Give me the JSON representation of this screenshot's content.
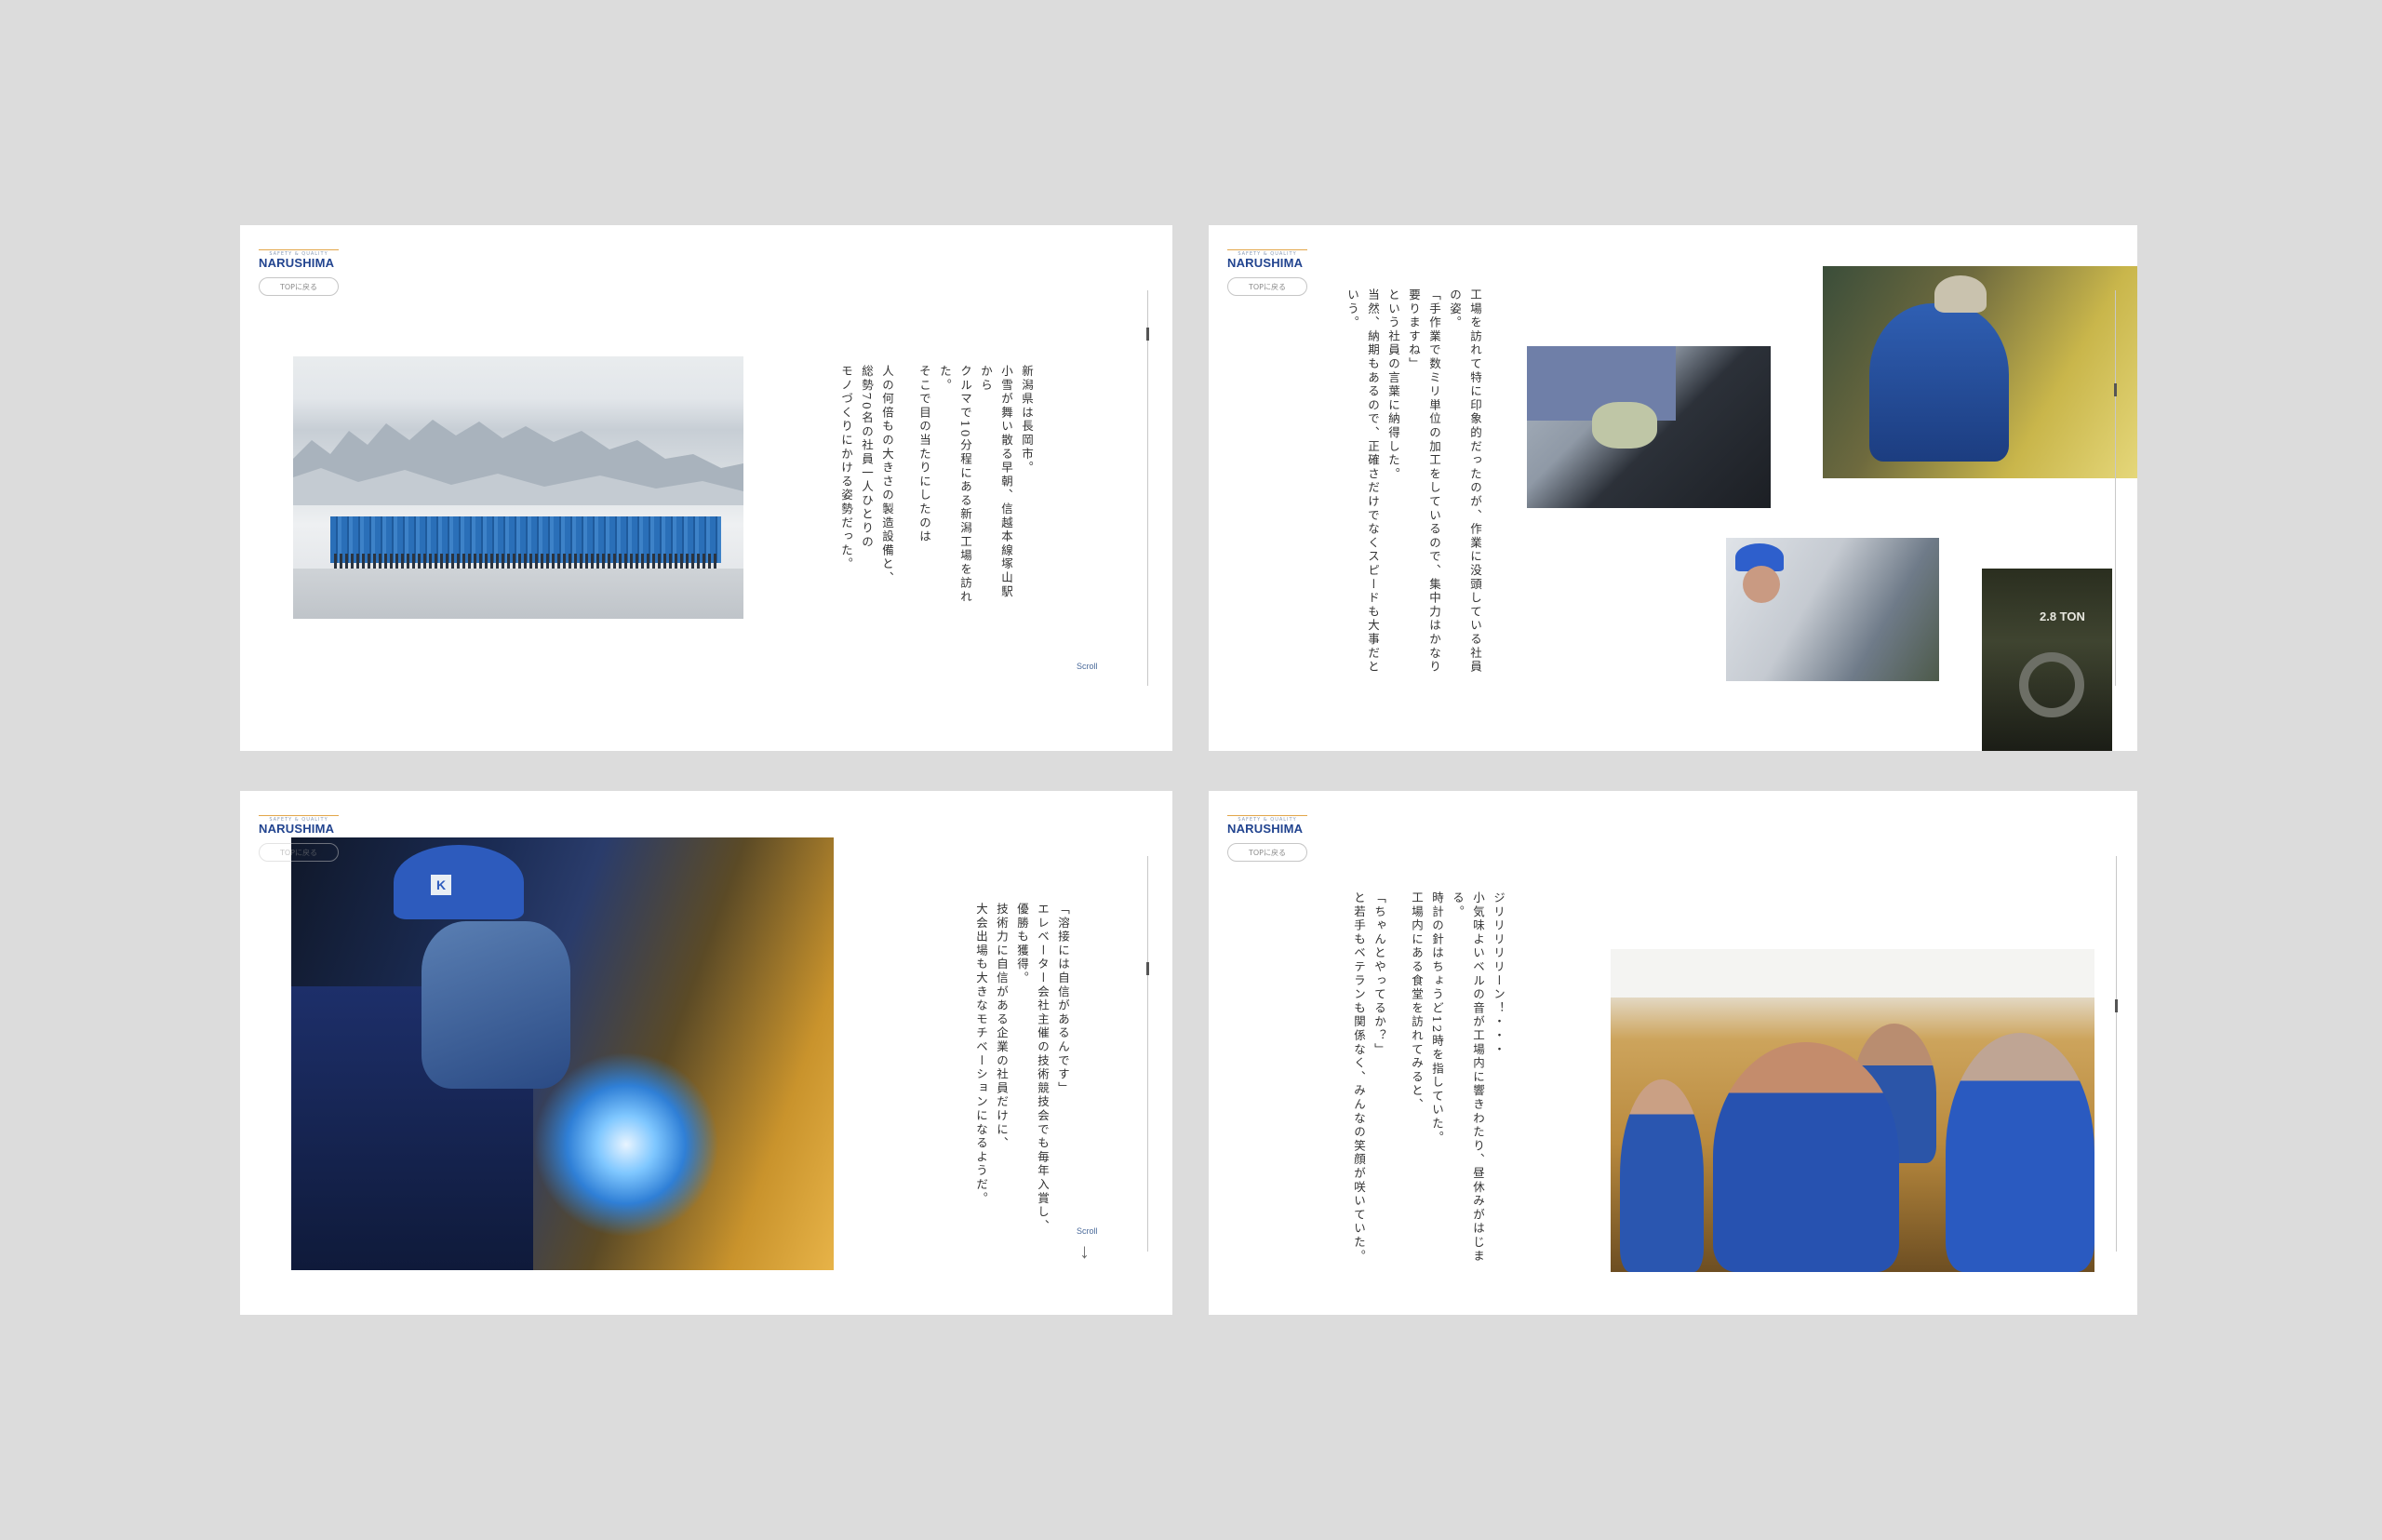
{
  "brand": {
    "tagline": "SAFETY & QUALITY",
    "name": "NARUSHIMA",
    "colors": {
      "brand_blue": "#22448f",
      "accent_orange": "#e3a64a",
      "background": "#dcdcdc"
    }
  },
  "nav": {
    "top_button": "TOPに戻る"
  },
  "panel1": {
    "paragraphs": [
      "新潟県は長岡市。",
      "小雪が舞い散る早朝、信越本線塚山駅から",
      "クルマで10分程にある新潟工場を訪れた。",
      "そこで目の当たりにしたのは",
      "人の何倍もの大きさの製造設備と、",
      "総勢70名の社員一人ひとりの",
      "モノづくりにかける姿勢だった。"
    ],
    "scroll": "Scroll"
  },
  "panel2": {
    "paragraphs": [
      "工場を訪れて特に印象的だったのが、作業に没頭している社員の姿。",
      "「手作業で数ミリ単位の加工をしているので、集中力はかなり要りますね」",
      "という社員の言葉に納得した。",
      "当然、納期もあるので、正確さだけでなくスピードも大事だという。"
    ],
    "hook_label": "2.8 TON"
  },
  "panel3": {
    "cap_letter": "K",
    "paragraphs": [
      "「溶接には自信があるんです」",
      "エレベーター会社主催の技術競技会でも毎年入賞し、",
      "優勝も獲得。",
      "技術力に自信がある企業の社員だけに、",
      "大会出場も大きなモチベーションになるようだ。"
    ],
    "scroll": "Scroll",
    "scroll_arrow": "↓"
  },
  "panel4": {
    "paragraphs": [
      "ジリリリリリーン！・・・",
      "小気味よいベルの音が工場内に響きわたり、昼休みがはじまる。",
      "時計の針はちょうど12時を指していた。",
      "工場内にある食堂を訪れてみると、",
      "「ちゃんとやってるか？」",
      "と若手もベテランも関係なく、みんなの笑顔が咲いていた。"
    ]
  }
}
